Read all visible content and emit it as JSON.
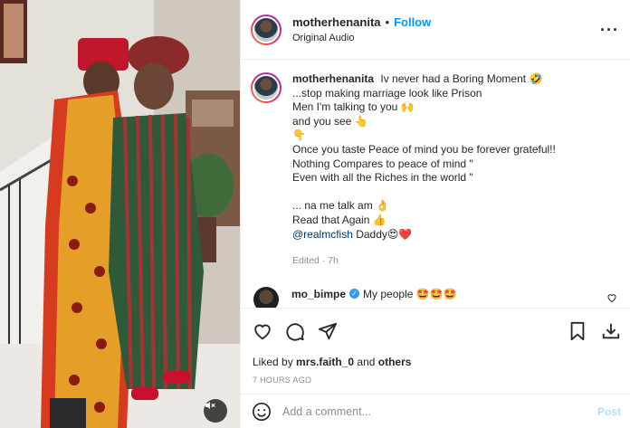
{
  "header": {
    "username": "motherhenanita",
    "separator": "•",
    "follow_label": "Follow",
    "audio_label": "Original Audio",
    "more_icon": "more-horizontal-icon"
  },
  "caption": {
    "username": "motherhenanita",
    "first_line": "Iv never had a Boring Moment 🤣",
    "lines": [
      "...stop making marriage look like Prison",
      "Men I'm talking to you 🙌",
      "and you see 👆",
      "👇",
      "Once you taste Peace of mind you be forever grateful!!",
      "Nothing Compares to peace of mind \"",
      "Even with all the Riches in the world \"",
      "",
      "... na me talk am 👌",
      "Read that Again 👍"
    ],
    "mention": "@realmcfish",
    "mention_suffix": " Daddy😍❤️",
    "edited": "Edited · 7h"
  },
  "comment": {
    "username": "mo_bimpe",
    "verified_mark": "✓",
    "text": "My people 🤩🤩🤩"
  },
  "actions": {
    "like_icon": "heart-icon",
    "comment_icon": "comment-bubble-icon",
    "share_icon": "paper-plane-icon",
    "save_icon": "bookmark-icon",
    "download_icon": "download-icon"
  },
  "likes": {
    "prefix": "Liked by ",
    "user": "mrs.faith_0",
    "middle": " and ",
    "others": "others"
  },
  "timestamp": "7 HOURS AGO",
  "add_comment": {
    "placeholder": "Add a comment...",
    "post_label": "Post",
    "emoji_icon": "smiley-icon"
  },
  "media": {
    "mute_icon": "speaker-muted-icon"
  },
  "colors": {
    "accent": "#0095f6",
    "muted": "#8e8e8e",
    "mention": "#00376b"
  }
}
